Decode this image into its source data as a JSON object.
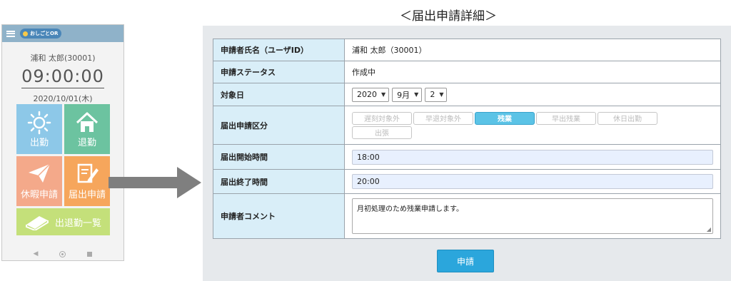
{
  "title": "＜届出申請詳細＞",
  "phone": {
    "logo_text": "おしごとOR",
    "user_name": "浦和 太郎(30001)",
    "clock": "09:00:00",
    "date": "2020/10/01(木)",
    "tiles": {
      "clock_in": "出勤",
      "clock_out": "退勤",
      "leave_request": "休暇申請",
      "notification_request": "届出申請",
      "attendance_list": "出退勤一覧"
    }
  },
  "form": {
    "rows": {
      "applicant": {
        "label": "申請者氏名（ユーザID）",
        "value": "浦和 太郎（30001）"
      },
      "status": {
        "label": "申請ステータス",
        "value": "作成中"
      },
      "target_date": {
        "label": "対象日",
        "year": "2020",
        "month": "9月",
        "day": "2"
      },
      "category": {
        "label": "届出申請区分",
        "options": [
          "遅刻対象外",
          "早退対象外",
          "残業",
          "早出残業",
          "休日出勤",
          "出張"
        ],
        "selected": "残業"
      },
      "start_time": {
        "label": "届出開始時間",
        "value": "18:00"
      },
      "end_time": {
        "label": "届出終了時間",
        "value": "20:00"
      },
      "comment": {
        "label": "申請者コメント",
        "value": "月初処理のため残業申請します。"
      }
    },
    "submit_label": "申請"
  },
  "colors": {
    "panel_bg": "#e6e9ec",
    "label_bg": "#d9eef8",
    "accent": "#2ba6dc",
    "selected_option": "#5bc3e6"
  }
}
